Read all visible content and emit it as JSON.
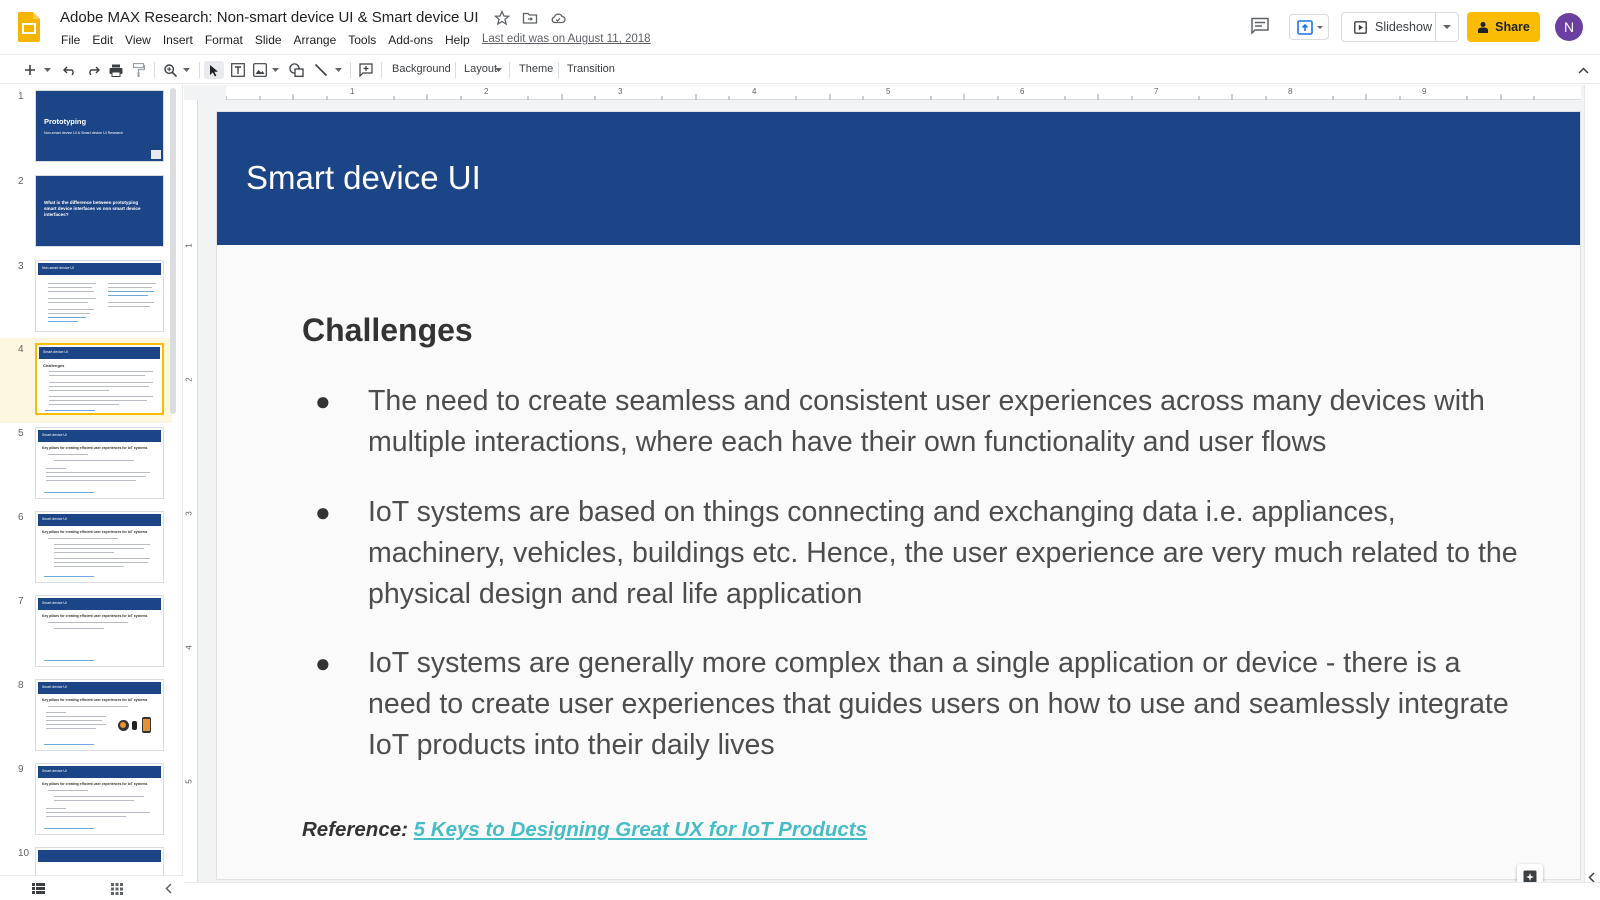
{
  "header": {
    "doc_title": "Adobe MAX Research: Non-smart device UI & Smart device UI",
    "last_edit": "Last edit was on August 11, 2018",
    "slideshow_label": "Slideshow",
    "share_label": "Share",
    "avatar_initial": "N",
    "menu": [
      "File",
      "Edit",
      "View",
      "Insert",
      "Format",
      "Slide",
      "Arrange",
      "Tools",
      "Add-ons",
      "Help"
    ]
  },
  "toolbar": {
    "background_label": "Background",
    "layout_label": "Layout",
    "theme_label": "Theme",
    "transition_label": "Transition"
  },
  "ruler": {
    "h_numbers": [
      "1",
      "2",
      "3",
      "4",
      "5",
      "6",
      "7",
      "8",
      "9"
    ],
    "v_numbers": [
      "1",
      "2",
      "3",
      "4",
      "5"
    ]
  },
  "filmstrip": {
    "numbers": [
      "1",
      "2",
      "3",
      "4",
      "5",
      "6",
      "7",
      "8",
      "9",
      "10"
    ],
    "thumb1_title": "Prototyping",
    "thumb1_sub": "Non-smart device UI & Smart device UI Research",
    "thumb2_text": "What is the difference between prototyping smart device interfaces vs non smart device interfaces?",
    "thumb3_bar": "Non-smart device UI",
    "thumb4_bar": "Smart device UI",
    "thumb4_heading": "Challenges",
    "thumb5_heading": "Key pillars for creating efficient user experiences for IoT systems",
    "active_index": 4
  },
  "slide": {
    "title": "Smart device UI",
    "subtitle": "Challenges",
    "bullets": [
      "The need to create seamless and consistent user experiences across many devices with multiple interactions, where each have their own functionality and user flows",
      "IoT systems are based on things connecting and exchanging data i.e. appliances, machinery, vehicles, buildings etc. Hence, the user experience are very much related to the physical design and real life application",
      "IoT systems are generally more complex than a single application or device - there is a need to create user experiences that guides users on how to use and seamlessly integrate IoT products into their daily lives"
    ],
    "bullet_char": "●",
    "reference_label": "Reference:",
    "reference_link": "5 Keys to Designing Great UX for IoT Products"
  },
  "colors": {
    "header_blue": "#1c4587",
    "accent_yellow": "#fbbc04",
    "link_teal": "#46bdc6",
    "avatar_purple": "#6b3fa0"
  },
  "icons": {
    "app": "slides-logo-icon",
    "star": "star-icon",
    "move": "folder-move-icon",
    "cloud": "cloud-saved-icon",
    "comments": "comment-history-icon",
    "present": "present-to-meet-icon",
    "share": "lock-person-icon"
  }
}
